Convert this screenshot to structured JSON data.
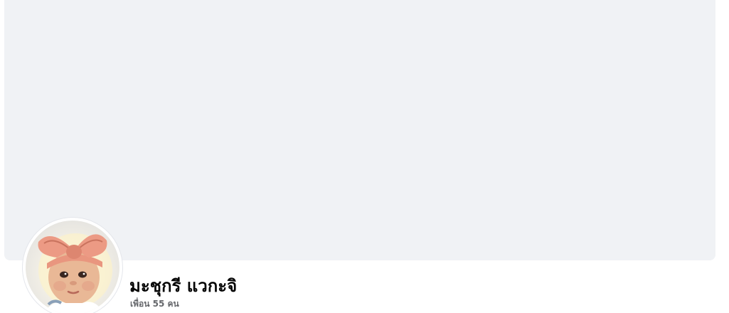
{
  "profile": {
    "name": "มะชุกรี แวกะจิ",
    "friends_count_text": "เพื่อน 55 คน"
  },
  "colors": {
    "cover_background": "#f0f2f5",
    "name_text": "#050505",
    "secondary_text": "#65676b"
  },
  "icons": {
    "avatar": "baby-with-pink-headband-photo"
  }
}
